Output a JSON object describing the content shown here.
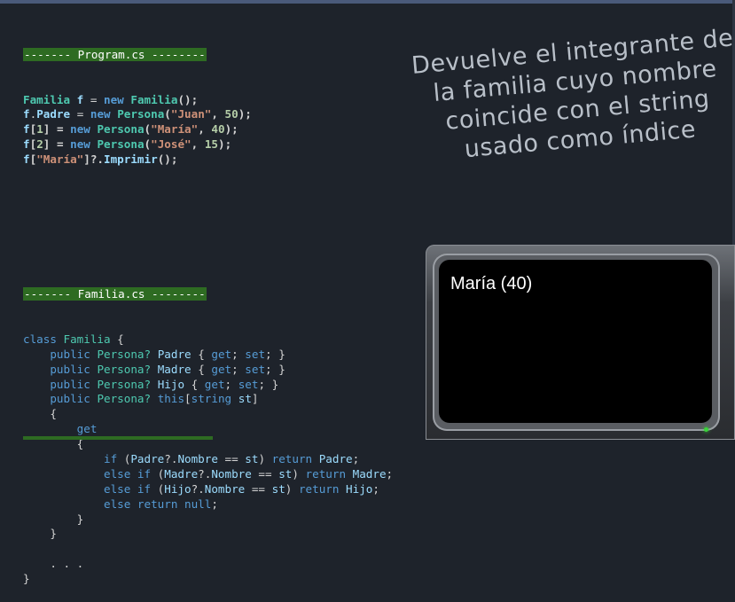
{
  "program": {
    "header": "------- Program.cs --------",
    "lines": [
      [
        {
          "t": "Familia",
          "c": "ty b"
        },
        {
          "t": " ",
          "c": "pl"
        },
        {
          "t": "f",
          "c": "id b"
        },
        {
          "t": " = ",
          "c": "pl"
        },
        {
          "t": "new",
          "c": "kw b"
        },
        {
          "t": " ",
          "c": "pl"
        },
        {
          "t": "Familia",
          "c": "ty b"
        },
        {
          "t": "();",
          "c": "pl b"
        }
      ],
      [
        {
          "t": "f",
          "c": "id b"
        },
        {
          "t": ".",
          "c": "pl"
        },
        {
          "t": "Padre",
          "c": "id b"
        },
        {
          "t": " = ",
          "c": "pl"
        },
        {
          "t": "new",
          "c": "kw b"
        },
        {
          "t": " ",
          "c": "pl"
        },
        {
          "t": "Persona",
          "c": "ty b"
        },
        {
          "t": "(",
          "c": "pl b"
        },
        {
          "t": "\"Juan\"",
          "c": "st b"
        },
        {
          "t": ", ",
          "c": "pl b"
        },
        {
          "t": "50",
          "c": "nu b"
        },
        {
          "t": ");",
          "c": "pl b"
        }
      ],
      [
        {
          "t": "f",
          "c": "id b"
        },
        {
          "t": "[",
          "c": "pl b"
        },
        {
          "t": "1",
          "c": "nu b"
        },
        {
          "t": "] = ",
          "c": "pl b"
        },
        {
          "t": "new",
          "c": "kw b"
        },
        {
          "t": " ",
          "c": "pl"
        },
        {
          "t": "Persona",
          "c": "ty b"
        },
        {
          "t": "(",
          "c": "pl b"
        },
        {
          "t": "\"María\"",
          "c": "st b"
        },
        {
          "t": ", ",
          "c": "pl b"
        },
        {
          "t": "40",
          "c": "nu b"
        },
        {
          "t": ");",
          "c": "pl b"
        }
      ],
      [
        {
          "t": "f",
          "c": "id b"
        },
        {
          "t": "[",
          "c": "pl b"
        },
        {
          "t": "2",
          "c": "nu b"
        },
        {
          "t": "] = ",
          "c": "pl b"
        },
        {
          "t": "new",
          "c": "kw b"
        },
        {
          "t": " ",
          "c": "pl"
        },
        {
          "t": "Persona",
          "c": "ty b"
        },
        {
          "t": "(",
          "c": "pl b"
        },
        {
          "t": "\"José\"",
          "c": "st b"
        },
        {
          "t": ", ",
          "c": "pl b"
        },
        {
          "t": "15",
          "c": "nu b"
        },
        {
          "t": ");",
          "c": "pl b"
        }
      ],
      [
        {
          "t": "f",
          "c": "id b"
        },
        {
          "t": "[",
          "c": "pl b"
        },
        {
          "t": "\"María\"",
          "c": "st b"
        },
        {
          "t": "]?.",
          "c": "pl b"
        },
        {
          "t": "Imprimir",
          "c": "id b"
        },
        {
          "t": "();",
          "c": "pl b"
        }
      ]
    ]
  },
  "familia": {
    "header": "------- Familia.cs --------",
    "lines": [
      [
        {
          "t": "class",
          "c": "kw"
        },
        {
          "t": " ",
          "c": "pl"
        },
        {
          "t": "Familia",
          "c": "ty"
        },
        {
          "t": " {",
          "c": "pl"
        }
      ],
      [
        {
          "t": "    ",
          "c": "pl"
        },
        {
          "t": "public",
          "c": "kw"
        },
        {
          "t": " ",
          "c": "pl"
        },
        {
          "t": "Persona?",
          "c": "ty"
        },
        {
          "t": " ",
          "c": "pl"
        },
        {
          "t": "Padre",
          "c": "id"
        },
        {
          "t": " { ",
          "c": "pl"
        },
        {
          "t": "get",
          "c": "kw"
        },
        {
          "t": "; ",
          "c": "pl"
        },
        {
          "t": "set",
          "c": "kw"
        },
        {
          "t": "; }",
          "c": "pl"
        }
      ],
      [
        {
          "t": "    ",
          "c": "pl"
        },
        {
          "t": "public",
          "c": "kw"
        },
        {
          "t": " ",
          "c": "pl"
        },
        {
          "t": "Persona?",
          "c": "ty"
        },
        {
          "t": " ",
          "c": "pl"
        },
        {
          "t": "Madre",
          "c": "id"
        },
        {
          "t": " { ",
          "c": "pl"
        },
        {
          "t": "get",
          "c": "kw"
        },
        {
          "t": "; ",
          "c": "pl"
        },
        {
          "t": "set",
          "c": "kw"
        },
        {
          "t": "; }",
          "c": "pl"
        }
      ],
      [
        {
          "t": "    ",
          "c": "pl"
        },
        {
          "t": "public",
          "c": "kw"
        },
        {
          "t": " ",
          "c": "pl"
        },
        {
          "t": "Persona?",
          "c": "ty"
        },
        {
          "t": " ",
          "c": "pl"
        },
        {
          "t": "Hijo",
          "c": "id"
        },
        {
          "t": " { ",
          "c": "pl"
        },
        {
          "t": "get",
          "c": "kw"
        },
        {
          "t": "; ",
          "c": "pl"
        },
        {
          "t": "set",
          "c": "kw"
        },
        {
          "t": "; }",
          "c": "pl"
        }
      ],
      [
        {
          "t": "    ",
          "c": "pl"
        },
        {
          "t": "public",
          "c": "kw"
        },
        {
          "t": " ",
          "c": "pl"
        },
        {
          "t": "Persona?",
          "c": "ty"
        },
        {
          "t": " ",
          "c": "pl"
        },
        {
          "t": "this",
          "c": "kw"
        },
        {
          "t": "[",
          "c": "pl"
        },
        {
          "t": "string",
          "c": "kw"
        },
        {
          "t": " ",
          "c": "pl"
        },
        {
          "t": "st",
          "c": "id"
        },
        {
          "t": "]",
          "c": "pl"
        }
      ],
      [
        {
          "t": "    {",
          "c": "pl"
        }
      ],
      [
        {
          "t": "        ",
          "c": "pl"
        },
        {
          "t": "get",
          "c": "kw"
        }
      ],
      [
        {
          "t": "        {",
          "c": "pl"
        }
      ],
      [
        {
          "t": "            ",
          "c": "pl"
        },
        {
          "t": "if",
          "c": "kw"
        },
        {
          "t": " (",
          "c": "pl"
        },
        {
          "t": "Padre",
          "c": "id"
        },
        {
          "t": "?.",
          "c": "pl"
        },
        {
          "t": "Nombre",
          "c": "id"
        },
        {
          "t": " == ",
          "c": "pl"
        },
        {
          "t": "st",
          "c": "id"
        },
        {
          "t": ") ",
          "c": "pl"
        },
        {
          "t": "return",
          "c": "kw"
        },
        {
          "t": " ",
          "c": "pl"
        },
        {
          "t": "Padre",
          "c": "id"
        },
        {
          "t": ";",
          "c": "pl"
        }
      ],
      [
        {
          "t": "            ",
          "c": "pl"
        },
        {
          "t": "else if",
          "c": "kw"
        },
        {
          "t": " (",
          "c": "pl"
        },
        {
          "t": "Madre",
          "c": "id"
        },
        {
          "t": "?.",
          "c": "pl"
        },
        {
          "t": "Nombre",
          "c": "id"
        },
        {
          "t": " == ",
          "c": "pl"
        },
        {
          "t": "st",
          "c": "id"
        },
        {
          "t": ") ",
          "c": "pl"
        },
        {
          "t": "return",
          "c": "kw"
        },
        {
          "t": " ",
          "c": "pl"
        },
        {
          "t": "Madre",
          "c": "id"
        },
        {
          "t": ";",
          "c": "pl"
        }
      ],
      [
        {
          "t": "            ",
          "c": "pl"
        },
        {
          "t": "else if",
          "c": "kw"
        },
        {
          "t": " (",
          "c": "pl"
        },
        {
          "t": "Hijo",
          "c": "id"
        },
        {
          "t": "?.",
          "c": "pl"
        },
        {
          "t": "Nombre",
          "c": "id"
        },
        {
          "t": " == ",
          "c": "pl"
        },
        {
          "t": "st",
          "c": "id"
        },
        {
          "t": ") ",
          "c": "pl"
        },
        {
          "t": "return",
          "c": "kw"
        },
        {
          "t": " ",
          "c": "pl"
        },
        {
          "t": "Hijo",
          "c": "id"
        },
        {
          "t": ";",
          "c": "pl"
        }
      ],
      [
        {
          "t": "            ",
          "c": "pl"
        },
        {
          "t": "else return",
          "c": "kw"
        },
        {
          "t": " ",
          "c": "pl"
        },
        {
          "t": "null",
          "c": "kw"
        },
        {
          "t": ";",
          "c": "pl"
        }
      ],
      [
        {
          "t": "        }",
          "c": "pl"
        }
      ],
      [
        {
          "t": "    }",
          "c": "pl"
        }
      ],
      [
        {
          "t": "",
          "c": "pl"
        }
      ],
      [
        {
          "t": "    . . .",
          "c": "pl"
        }
      ],
      [
        {
          "t": "}",
          "c": "pl"
        }
      ]
    ]
  },
  "description": "Devuelve el integrante de la familia cuyo nombre coincide con el string usado como índice",
  "console": {
    "output": "María (40)"
  },
  "colors": {
    "background": "#1e232b",
    "header_bg": "#2e6b22",
    "keyword": "#569cd6",
    "type": "#4ec9b0",
    "identifier": "#9cdcfe",
    "string": "#ce9178",
    "number": "#b5cea8"
  }
}
